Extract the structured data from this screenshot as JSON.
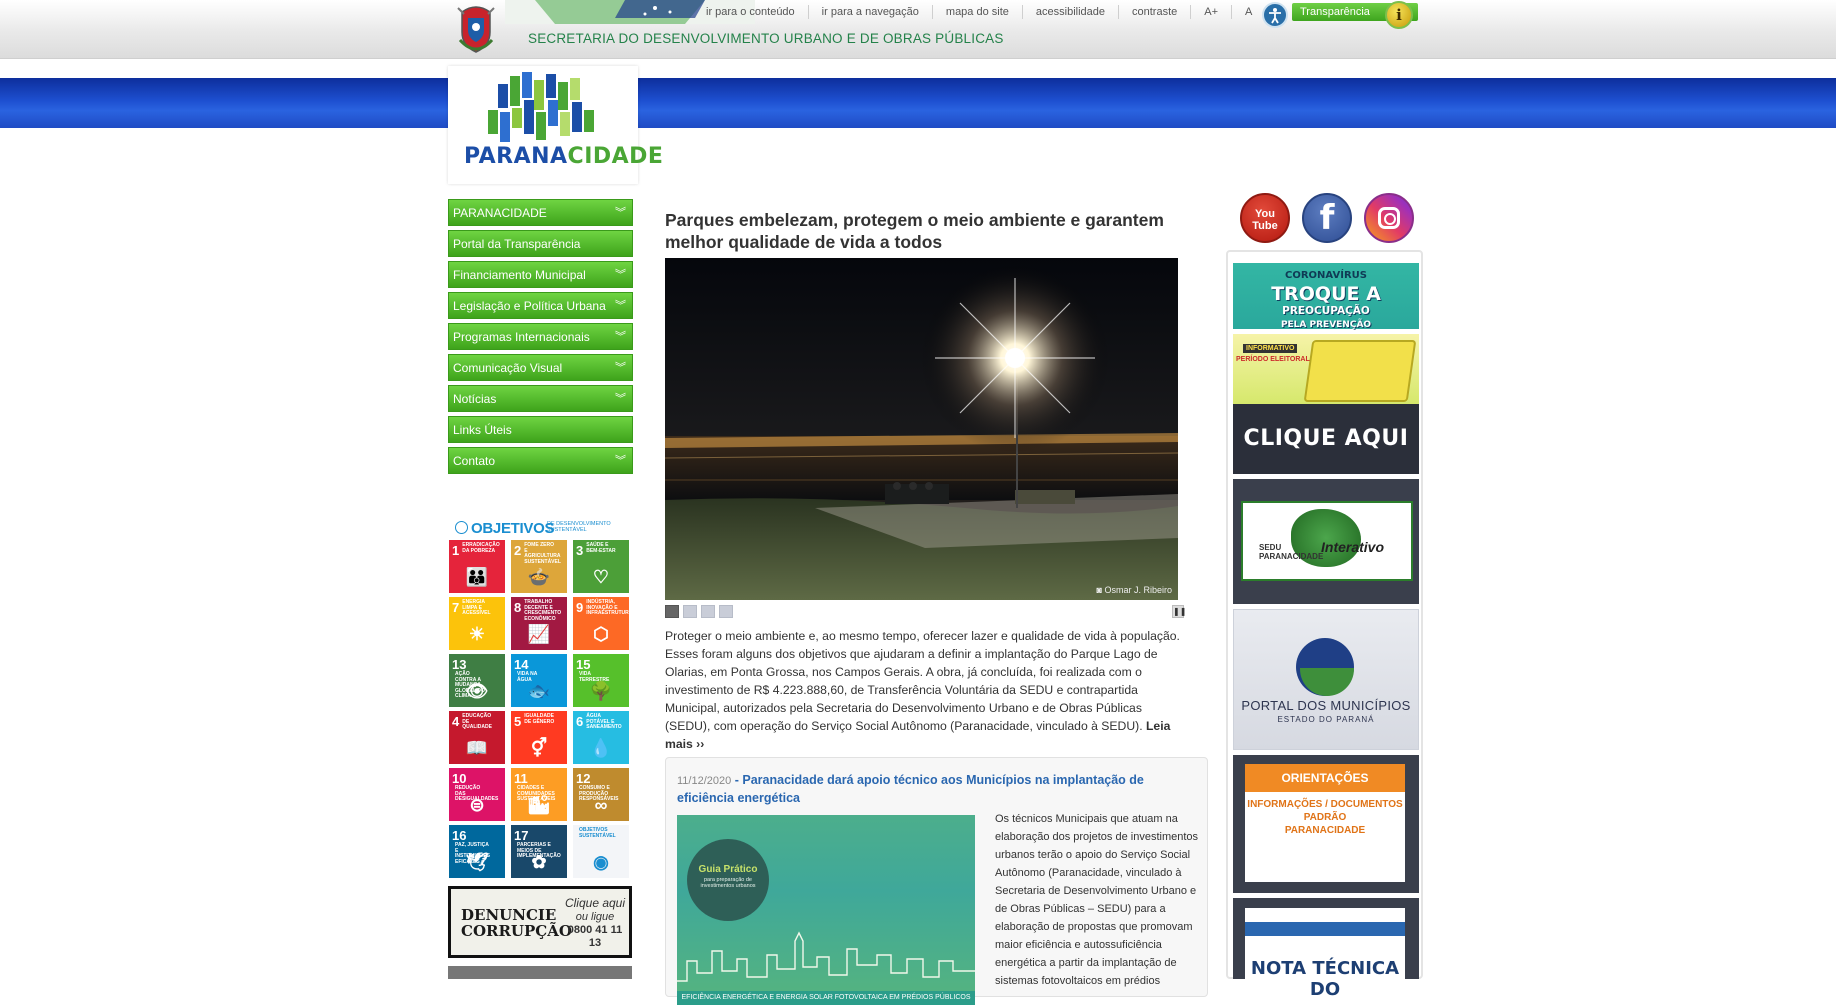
{
  "header": {
    "secretaria": "SECRETARIA DO DESENVOLVIMENTO URBANO E DE OBRAS PÚBLICAS",
    "links": [
      "ir para o conteúdo",
      "ir para a navegação",
      "mapa do site",
      "acessibilidade",
      "contraste",
      "A+",
      "A"
    ],
    "transparencia": "Transparência",
    "info_glyph": "i"
  },
  "logo": {
    "part1": "PARANA",
    "part2": "CIDADE"
  },
  "nav": [
    {
      "label": "PARANACIDADE",
      "chevron": true
    },
    {
      "label": "Portal da Transparência",
      "chevron": false
    },
    {
      "label": "Financiamento Municipal",
      "chevron": true
    },
    {
      "label": "Legislação e Política Urbana",
      "chevron": true
    },
    {
      "label": "Programas Internacionais",
      "chevron": true
    },
    {
      "label": "Comunicação Visual",
      "chevron": true
    },
    {
      "label": "Notícias",
      "chevron": true
    },
    {
      "label": "Links Úteis",
      "chevron": false
    },
    {
      "label": "Contato",
      "chevron": true
    }
  ],
  "sdg": {
    "header_main": "OBJETIVOS",
    "header_sub": "DE DESENVOLVIMENTO SUSTENTÁVEL",
    "tiles": [
      {
        "num": "1",
        "label": "ERRADICAÇÃO DA POBREZA",
        "color": "#e5243b",
        "glyph": "👪"
      },
      {
        "num": "2",
        "label": "FOME ZERO E AGRICULTURA SUSTENTÁVEL",
        "color": "#dda63a",
        "glyph": "🍲"
      },
      {
        "num": "3",
        "label": "SAÚDE E BEM-ESTAR",
        "color": "#4c9f38",
        "glyph": "♡"
      },
      {
        "num": "7",
        "label": "ENERGIA LIMPA E ACESSÍVEL",
        "color": "#fcc30b",
        "glyph": "☀"
      },
      {
        "num": "8",
        "label": "TRABALHO DECENTE E CRESCIMENTO ECONÔMICO",
        "color": "#a21942",
        "glyph": "📈"
      },
      {
        "num": "9",
        "label": "INDÚSTRIA, INOVAÇÃO E INFRAESTRUTURA",
        "color": "#fd6925",
        "glyph": "⬡"
      },
      {
        "num": "13",
        "label": "AÇÃO CONTRA A MUDANÇA GLOBAL DO CLIMA",
        "color": "#3f7e44",
        "glyph": "👁"
      },
      {
        "num": "14",
        "label": "VIDA NA ÁGUA",
        "color": "#0a97d9",
        "glyph": "🐟"
      },
      {
        "num": "15",
        "label": "VIDA TERRESTRE",
        "color": "#56c02b",
        "glyph": "🌳"
      },
      {
        "num": "4",
        "label": "EDUCAÇÃO DE QUALIDADE",
        "color": "#c5192d",
        "glyph": "📖"
      },
      {
        "num": "5",
        "label": "IGUALDADE DE GÊNERO",
        "color": "#ff3a21",
        "glyph": "⚥"
      },
      {
        "num": "6",
        "label": "ÁGUA POTÁVEL E SANEAMENTO",
        "color": "#26bde2",
        "glyph": "💧"
      },
      {
        "num": "10",
        "label": "REDUÇÃO DAS DESIGUALDADES",
        "color": "#dd1367",
        "glyph": "⊜"
      },
      {
        "num": "11",
        "label": "CIDADES E COMUNIDADES SUSTENTÁVEIS",
        "color": "#fd9d24",
        "glyph": "🏙"
      },
      {
        "num": "12",
        "label": "CONSUMO E PRODUÇÃO RESPONSÁVEIS",
        "color": "#bf8b2e",
        "glyph": "∞"
      },
      {
        "num": "16",
        "label": "PAZ, JUSTIÇA E INSTITUIÇÕES EFICAZES",
        "color": "#00689d",
        "glyph": "🕊"
      },
      {
        "num": "17",
        "label": "PARCERIAS E MEIOS DE IMPLEMENTAÇÃO",
        "color": "#19486a",
        "glyph": "✿"
      },
      {
        "num": "",
        "label": "OBJETIVOS SUSTENTÁVEL",
        "color": "#f3f5f8",
        "glyph": "◉"
      }
    ]
  },
  "denuncie": {
    "title1": "DENUNCIE",
    "title2": "CORRUPÇÃO",
    "cta1": "Clique aqui",
    "cta2": "ou ligue",
    "phone": "0800 41 11 13"
  },
  "main": {
    "headline": "Parques embelezam, protegem o meio ambiente e garantem melhor qualidade de vida a todos",
    "photo_credit": "Osmar J. Ribeiro",
    "slides": 4,
    "active_slide": 1,
    "summary": "Proteger o meio ambiente e, ao mesmo tempo, oferecer lazer e qualidade de vida à população. Esses foram alguns dos objetivos que ajudaram a definir a implantação do Parque Lago de Olarias, em Ponta Grossa, nos Campos Gerais. A obra, já concluída, foi realizada com o investimento de R$ 4.223.888,60, de Transferência Voluntária da SEDU e contrapartida Municipal, autorizados pela Secretaria do Desenvolvimento Urbano e de Obras Públicas (SEDU), com operação do Serviço Social Autônomo (Paranacidade, vinculado à SEDU).",
    "read_more": "Leia mais ››"
  },
  "news": {
    "date": "11/12/2020",
    "title": "- Paranacidade dará apoio técnico aos Municípios na implantação de eficiência energética",
    "image_title": "Guia Prático",
    "image_sub": "para preparação de investimentos urbanos",
    "image_strip": "EFICIÊNCIA ENERGÉTICA E ENERGIA SOLAR FOTOVOLTAICA EM PRÉDIOS PÚBLICOS",
    "text": "Os técnicos Municipais que atuam na elaboração dos projetos de investimentos urbanos terão o apoio do Serviço Social Autônomo (Paranacidade, vinculado à Secretaria de Desenvolvimento Urbano e de Obras Públicas – SEDU) para a elaboração de propostas que promovam maior eficiência e autossuficiência energética a partir da implantação de sistemas fotovoltaicos em prédios"
  },
  "social": {
    "youtube_line1": "You",
    "youtube_line2": "Tube",
    "facebook": "f"
  },
  "banners": {
    "corona_1": "CORONAVÍRUS",
    "corona_2": "TROQUE A",
    "corona_3": "PREOCUPAÇÃO",
    "corona_4": "PELA PREVENÇÃO",
    "eleitoral_tag": "INFORMATIVO",
    "eleitoral_sub": "PERÍODO ELEITORAL",
    "eleitoral_cta": "CLIQUE AQUI",
    "interativo_small1": "SEDU",
    "interativo_small2": "PARANACIDADE",
    "interativo": "Interativo",
    "portal_1": "PORTAL DOS MUNICÍPIOS",
    "portal_2": "ESTADO DO PARANÁ",
    "orient_head": "ORIENTAÇÕES",
    "orient_body1": "INFORMAÇÕES / DOCUMENTOS",
    "orient_body2": "PADRÃO",
    "orient_body3": "PARANACIDADE",
    "nota": "NOTA TÉCNICA DO"
  }
}
